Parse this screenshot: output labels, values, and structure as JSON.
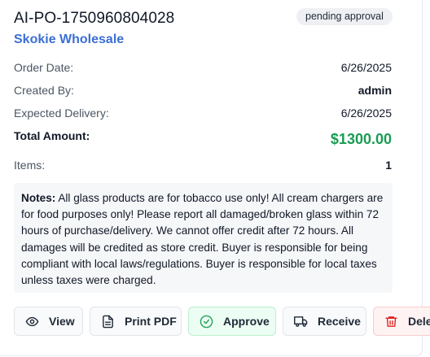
{
  "order": {
    "po_number": "AI-PO-1750960804028",
    "status": "pending approval",
    "supplier": "Skokie Wholesale"
  },
  "details": {
    "order_date_label": "Order Date:",
    "order_date": "6/26/2025",
    "created_by_label": "Created By:",
    "created_by": "admin",
    "expected_delivery_label": "Expected Delivery:",
    "expected_delivery": "6/26/2025",
    "total_label": "Total Amount:",
    "total": "$1300.00",
    "items_label": "Items:",
    "items": "1"
  },
  "notes": {
    "label": "Notes:",
    "text": " All glass products are for tobacco use only! All cream chargers are for food purposes only! Please report all damaged/broken glass within 72 hours of purchase/delivery. We cannot offer credit after 72 hours. All damages will be credited as store credit. Buyer is responsible for being compliant with local laws/regulations. Buyer is responsible for local taxes unless taxes were charged."
  },
  "actions": {
    "view": "View",
    "print_pdf": "Print PDF",
    "approve": "Approve",
    "receive": "Receive",
    "delete": "Delete"
  },
  "colors": {
    "supplier_link": "#3b6fd4",
    "total_amount": "#1a9c52",
    "approve_icon": "#22a35a",
    "delete_icon": "#dc2626"
  },
  "icons": {
    "view": "eye-icon",
    "print_pdf": "document-icon",
    "approve": "check-circle-icon",
    "receive": "truck-icon",
    "delete": "trash-icon"
  }
}
